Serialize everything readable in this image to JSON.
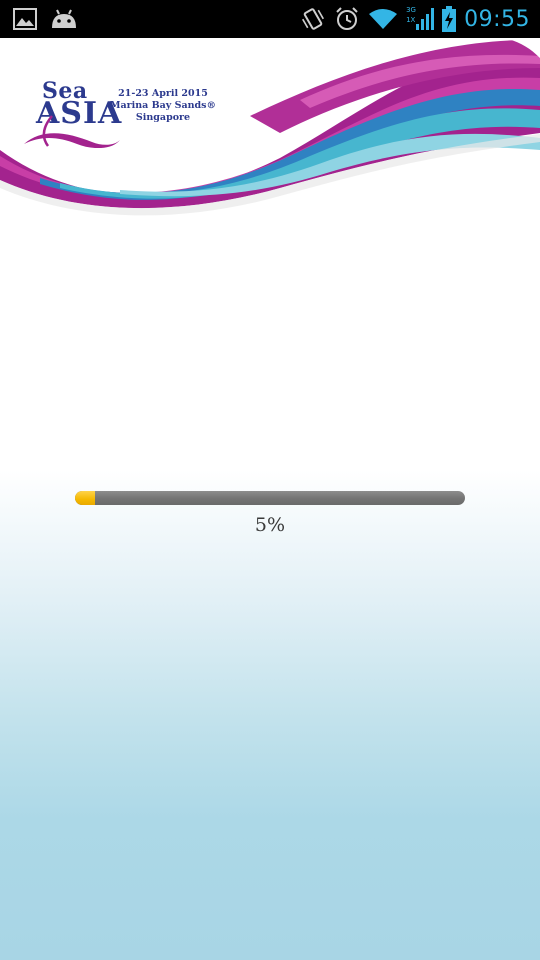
{
  "status_bar": {
    "time": "09:55",
    "network_type_top": "3G",
    "network_type_bottom": "1X",
    "icons": [
      "gallery-icon",
      "android-icon",
      "vibrate-icon",
      "alarm-icon",
      "wifi-icon",
      "signal-icon",
      "battery-charging-icon"
    ],
    "accent_color": "#33b5e5"
  },
  "header": {
    "logo_line1": "Sea",
    "logo_line2": "ASIA",
    "event_dates": "21-23 April 2015",
    "event_venue": "Marina Bay Sands®",
    "event_city": "Singapore",
    "brand_colors": [
      "#a3238e",
      "#2c3a8e",
      "#47b6cf"
    ]
  },
  "loading": {
    "progress_percent": 5,
    "progress_label": "5%",
    "fill_color": "#f5b800",
    "track_color": "#757575"
  }
}
